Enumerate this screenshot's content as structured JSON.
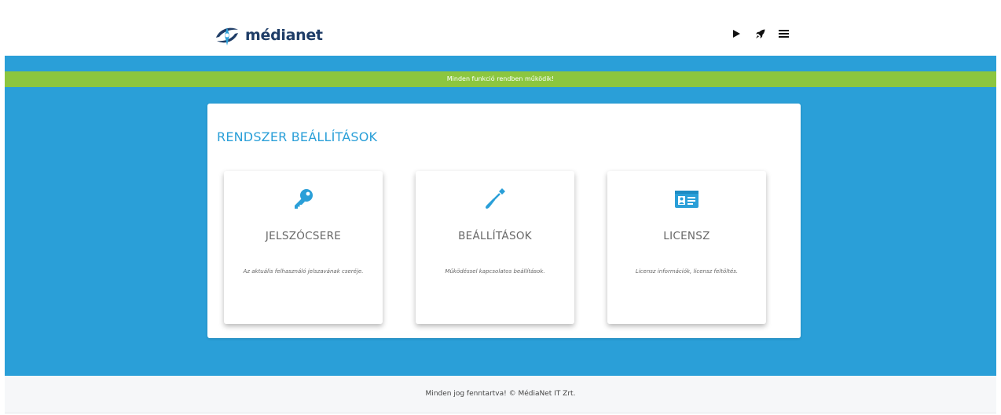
{
  "brand": {
    "name": "médianet"
  },
  "header": {
    "actions": [
      {
        "icon": "play-icon"
      },
      {
        "icon": "rocket-icon"
      },
      {
        "icon": "hamburger-menu-icon"
      }
    ]
  },
  "status": {
    "message": "Minden funkció rendben működik!",
    "color": "#8cc63f"
  },
  "panel": {
    "title": "RENDSZER BEÁLLÍTÁSOK",
    "cards": [
      {
        "icon": "key-icon",
        "title": "JELSZÓCSERE",
        "description": "Az aktuális felhasználó jelszavának cseréje."
      },
      {
        "icon": "screwdriver-icon",
        "title": "BEÁLLÍTÁSOK",
        "description": "Működéssel kapcsolatos beállítások."
      },
      {
        "icon": "id-card-icon",
        "title": "LICENSZ",
        "description": "Licensz információk, licensz feltöltés."
      }
    ]
  },
  "footer": {
    "text": "Minden jog fenntartva! © MédiaNet IT Zrt."
  },
  "colors": {
    "accent": "#2a9fd8",
    "success": "#8cc63f",
    "brand_dark": "#1f3d67"
  }
}
